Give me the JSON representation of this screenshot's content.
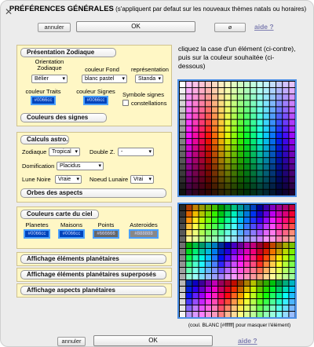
{
  "header": {
    "title": "PRÉFÉRENCES GÉNÉRALES",
    "subtitle": "(s'appliquent par defaut sur les nouveaux thèmes natals ou horaires)",
    "annuler_label": "annuler",
    "ok_label": "OK",
    "reset_label": "ø",
    "aide_label": "aide ?"
  },
  "zodiac": {
    "section": "Présentation Zodiaque",
    "orientation_label": "Orientation Zodiaque",
    "orientation_value": "Bélier",
    "couleur_fond_label": "couleur Fond",
    "couleur_fond_value": "blanc pastel",
    "representation_label": "représentation",
    "representation_value": "Standa",
    "couleur_traits_label": "couleur Traits",
    "couleur_traits_value": "#0066cc",
    "couleur_signes_label": "couleur Signes",
    "couleur_signes_value": "#0066cc",
    "symbole_signes_label": "Symbole signes",
    "constellations_label": "constellations",
    "couleurs_signes_button": "Couleurs des signes"
  },
  "calculs": {
    "section": "Calculs astro.",
    "zodiaque_label": "Zodiaque",
    "zodiaque_value": "Tropical",
    "double_z_label": "Double Z.",
    "double_z_value": "-",
    "domification_label": "Domification",
    "domification_value": "Placidus",
    "lune_noire_label": "Lune Noire",
    "lune_noire_value": "Vraie",
    "noeud_lunaire_label": "Noeud Lunaire",
    "noeud_lunaire_value": "Vrai",
    "orbes_button": "Orbes des aspects"
  },
  "couleurs_carte": {
    "section": "Couleurs carte du ciel",
    "planetes_label": "Planetes",
    "planetes_value": "#0066cc",
    "maisons_label": "Maisons",
    "maisons_value": "#0066cc",
    "points_label": "Points",
    "points_value": "#666666",
    "asteroides_label": "Asteroides",
    "asteroides_value": "#888888"
  },
  "affichage": {
    "elements": "Affichage éléments planétaires",
    "superposes": "Affichage éléments planétaires superposés",
    "aspects": "Affichage aspects planétaires"
  },
  "palette": {
    "instruction": "cliquez la case d'un élément (ci-contre), puis sur la couleur souhaitée (ci-dessous)",
    "footnote": "(coul. BLANC [#ffffff] pour masquer l'élément)"
  },
  "footer": {
    "annuler_label": "annuler",
    "ok_label": "OK",
    "aide_label": "aide ?"
  },
  "colors": {
    "panel_bg": "#fff7c5",
    "accent": "#4aa0ff",
    "aide_link": "#7d7db0"
  }
}
